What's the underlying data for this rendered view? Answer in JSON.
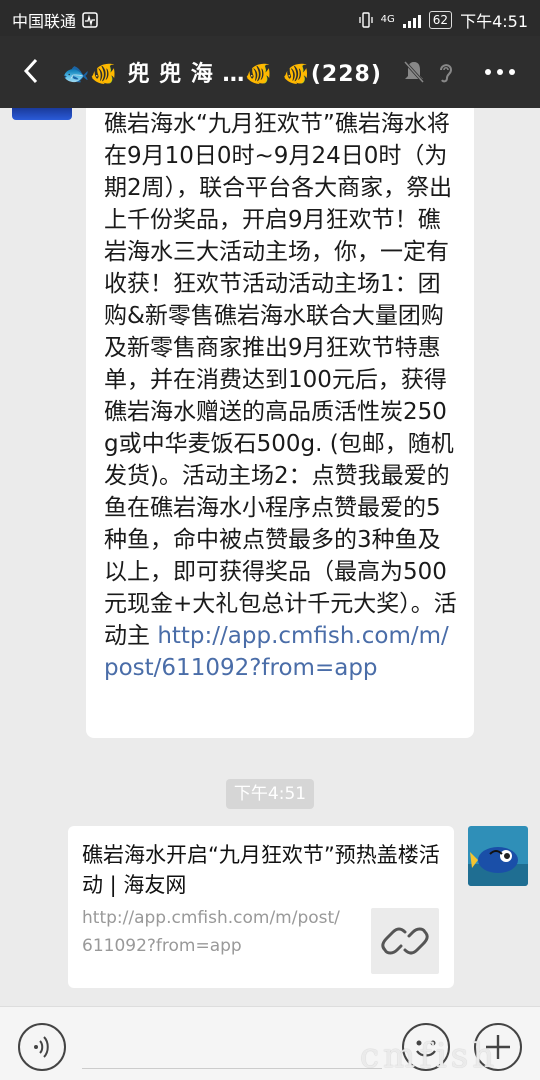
{
  "status_bar": {
    "carrier": "中国联通",
    "network": "4G",
    "battery": "62",
    "time": "下午4:51"
  },
  "header": {
    "back_icon": "chevron-left-icon",
    "title": "🐟🐠 兜 兜 海 …🐠 🐠(228)",
    "icons": [
      "mute-icon",
      "ear-icon",
      "more-icon"
    ]
  },
  "message_left": {
    "text": "礁岩海水“九月狂欢节”礁岩海水将在9月10日0时~9月24日0时（为期2周），联合平台各大商家，祭出上千份奖品，开启9月狂欢节！礁岩海水三大活动主场，你，一定有收获！狂欢节活动活动主场1：团购&新零售礁岩海水联合大量团购及新零售商家推出9月狂欢节特惠单，并在消费达到100元后，获得礁岩海水赠送的高品质活性炭250g或中华麦饭石500g. (包邮，随机发货)。活动主场2：点赞我最爱的鱼在礁岩海水小程序点赞最爱的5种鱼，命中被点赞最多的3种鱼及以上，即可获得奖品（最高为500元现金+大礼包总计千元大奖）。活动主 ",
    "link": "http://app.cmfish.com/m/post/611092?from=app"
  },
  "time_divider": "下午4:51",
  "link_card": {
    "title": "礁岩海水开启“九月狂欢节”预热盖楼活动 | 海友网",
    "url": "http://app.cmfish.com/m/post/611092?from=app",
    "thumb_icon": "link-icon"
  },
  "input_bar": {
    "icons": [
      "voice-icon",
      "emoji-icon",
      "add-icon"
    ]
  },
  "watermark": "cmfish",
  "colors": {
    "title_bar": "#2e2e2e",
    "chat_bg": "#ebebeb",
    "link": "#4a6da8",
    "bubble": "#ffffff"
  }
}
